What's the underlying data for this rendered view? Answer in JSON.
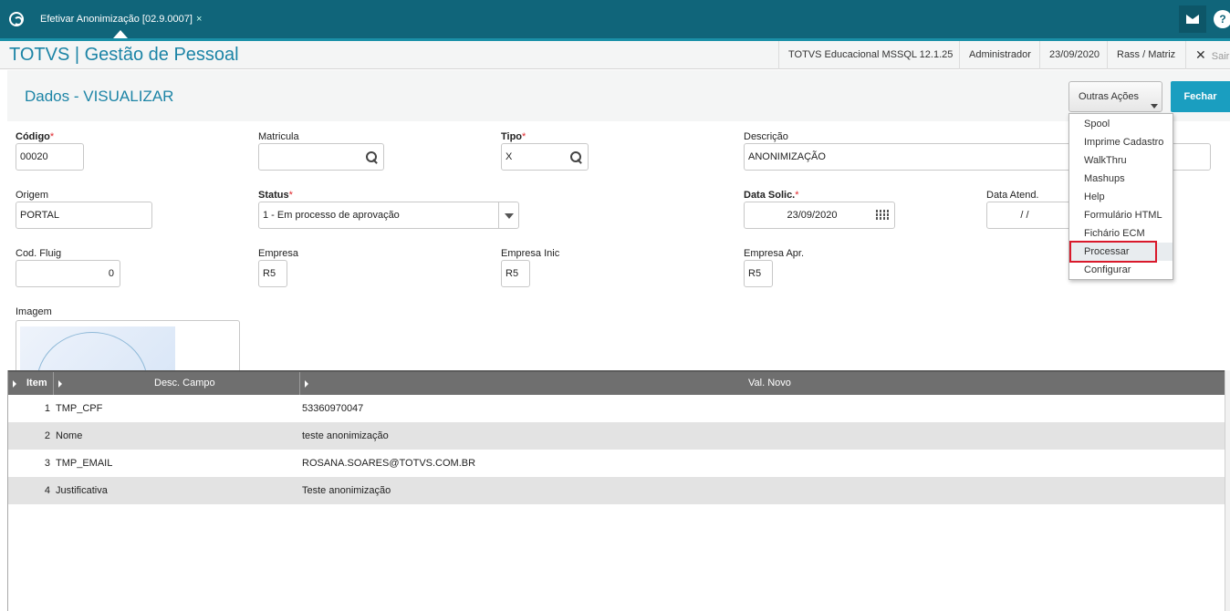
{
  "topbar": {
    "tab_label": "Efetivar Anonimização [02.9.0007]",
    "tab_close": "×",
    "help": "?"
  },
  "header": {
    "brand": "TOTVS | Gestão de Pessoal",
    "system": "TOTVS Educacional MSSQL 12.1.25",
    "user": "Administrador",
    "date": "23/09/2020",
    "branch": "Rass / Matriz",
    "exit_icon": "✕",
    "exit_label": "Sair"
  },
  "page": {
    "title": "Dados - VISUALIZAR"
  },
  "actions": {
    "outras_acoes": "Outras Ações",
    "fechar": "Fechar"
  },
  "menu": {
    "items": [
      "Spool",
      "Imprime Cadastro",
      "WalkThru",
      "Mashups",
      "Help",
      "Formulário HTML",
      "Fichário ECM",
      "Processar",
      "Configurar"
    ],
    "highlighted": "Processar"
  },
  "form": {
    "codigo": {
      "label": "Código",
      "value": "00020"
    },
    "matricula": {
      "label": "Matricula",
      "value": ""
    },
    "tipo": {
      "label": "Tipo",
      "value": "X"
    },
    "descricao": {
      "label": "Descrição",
      "value": "ANONIMIZAÇÃO"
    },
    "origem": {
      "label": "Origem",
      "value": "PORTAL"
    },
    "status": {
      "label": "Status",
      "value": "1 - Em processo de aprovação"
    },
    "data_solic": {
      "label": "Data Solic.",
      "value": "23/09/2020"
    },
    "data_atend": {
      "label": "Data Atend.",
      "value": "/  /"
    },
    "cod_fluig": {
      "label": "Cod. Fluig",
      "value": "0"
    },
    "empresa": {
      "label": "Empresa",
      "value": "R5"
    },
    "empresa_inic": {
      "label": "Empresa Inic",
      "value": "R5"
    },
    "empresa_apr": {
      "label": "Empresa Apr.",
      "value": "R5"
    },
    "imagem": {
      "label": "Imagem"
    },
    "required_mark": "*"
  },
  "grid": {
    "columns": [
      "Item",
      "Desc. Campo",
      "Val. Novo"
    ],
    "rows": [
      {
        "item": "1",
        "campo": "TMP_CPF",
        "valor": "53360970047"
      },
      {
        "item": "2",
        "campo": "Nome",
        "valor": "teste anonimização"
      },
      {
        "item": "3",
        "campo": "TMP_EMAIL",
        "valor": "ROSANA.SOARES@TOTVS.COM.BR"
      },
      {
        "item": "4",
        "campo": "Justificativa",
        "valor": "Teste anonimização"
      }
    ]
  },
  "colors": {
    "topbar": "#10657a",
    "accent": "#1c84a6",
    "primary_button": "#1a9ec0",
    "highlight_border": "#d9192b"
  }
}
